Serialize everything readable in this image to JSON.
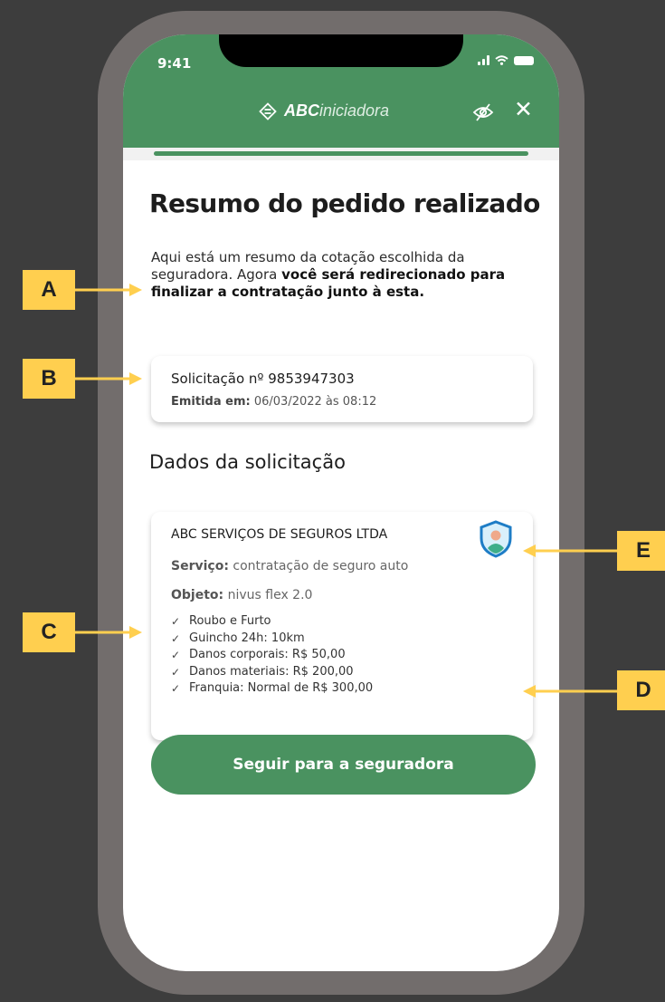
{
  "status_bar": {
    "time": "9:41"
  },
  "header": {
    "brand_bold": "ABC",
    "brand_light": "iniciadora",
    "icons": [
      "logo-icon",
      "eye-off-icon",
      "close-icon"
    ],
    "close_glyph": "✕"
  },
  "progress": {
    "value": 1.0
  },
  "page": {
    "title": "Resumo do pedido realizado",
    "intro_plain": "Aqui está um resumo da cotação escolhida da seguradora. Agora ",
    "intro_bold": "você será redirecionado para finalizar a contratação junto à esta."
  },
  "request_card": {
    "number": "Solicitação nº 9853947303",
    "issued_label": "Emitida em:",
    "issued_value": " 06/03/2022 às 08:12"
  },
  "details": {
    "section_title": "Dados da solicitação",
    "company": "ABC SERVIÇOS DE SEGUROS LTDA",
    "service_label": "Serviço:",
    "service_value": " contratação de seguro auto",
    "object_label": "Objeto:",
    "object_value": " nivus flex 2.0",
    "coverage": [
      "Roubo e Furto",
      "Guincho 24h: 10km",
      "Danos corporais: R$ 50,00",
      "Danos materiais: R$ 200,00",
      "Franquia: Normal de R$ 300,00"
    ],
    "check_glyph": "✓"
  },
  "cta": {
    "label": "Seguir para a seguradora"
  },
  "callouts": [
    "A",
    "B",
    "C",
    "D",
    "E"
  ],
  "colors": {
    "primary": "#4a9260",
    "callout": "#ffcf4f",
    "frame": "#726d6c",
    "background": "#3d3d3d"
  }
}
